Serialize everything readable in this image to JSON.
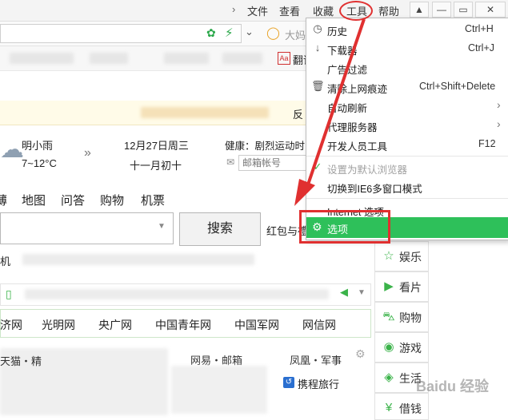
{
  "menubar": {
    "items": [
      "文件",
      "查看",
      "收藏",
      "工具",
      "帮助"
    ],
    "window_buttons": [
      "shirt-icon",
      "minimize-icon",
      "maximize-icon",
      "close-icon"
    ]
  },
  "addressbar": {
    "search_hint": "大妈"
  },
  "bookmarks": {
    "visible_item": "翻译"
  },
  "notice": {
    "text": "反"
  },
  "weather": {
    "condition": "明小雨",
    "temp": "7~12°C",
    "date": "12月27日周三",
    "lunar": "十一月初十",
    "health_prefix": "健康：剧烈运动时",
    "mail_placeholder": "邮箱帐号"
  },
  "nav": {
    "links": [
      "薄",
      "地图",
      "问答",
      "购物",
      "机票"
    ]
  },
  "search": {
    "button": "搜索",
    "side_text": "红包与禮"
  },
  "hot": {
    "prefix": "机"
  },
  "sites": {
    "links": [
      "济网",
      "光明网",
      "央广网",
      "中国青年网",
      "中国军网",
      "网信网"
    ]
  },
  "grid": {
    "cell_a": "网易・邮箱",
    "cell_b": "凤凰・军事",
    "cell_c": "携程旅行",
    "cell_d": "天猫・精"
  },
  "side_panel": {
    "items": [
      {
        "label": "娱乐",
        "icon": "star-icon"
      },
      {
        "label": "看片",
        "icon": "play-icon"
      },
      {
        "label": "购物",
        "icon": "cart-icon"
      },
      {
        "label": "游戏",
        "icon": "gamepad-icon"
      },
      {
        "label": "生活",
        "icon": "life-icon"
      },
      {
        "label": "借钱",
        "icon": "money-icon"
      }
    ]
  },
  "dropdown": {
    "items": [
      {
        "label": "历史",
        "shortcut": "Ctrl+H",
        "icon": "clock-icon"
      },
      {
        "label": "下载器",
        "shortcut": "Ctrl+J",
        "icon": "download-icon"
      },
      {
        "label": "广告过滤",
        "shortcut": "",
        "icon": ""
      },
      {
        "label": "清除上网痕迹",
        "shortcut": "Ctrl+Shift+Delete",
        "icon": "trash-icon"
      },
      {
        "label": "自动刷新",
        "shortcut": "",
        "icon": "",
        "submenu": true
      },
      {
        "label": "代理服务器",
        "shortcut": "",
        "icon": "",
        "submenu": true
      },
      {
        "label": "开发人员工具",
        "shortcut": "F12",
        "icon": ""
      },
      {
        "label": "设置为默认浏览器",
        "shortcut": "",
        "icon": "check-icon",
        "disabled": true
      },
      {
        "label": "切换到IE6多窗口模式",
        "shortcut": "",
        "icon": ""
      },
      {
        "label": "Internet 选项",
        "shortcut": "",
        "icon": ""
      },
      {
        "label": "选项",
        "shortcut": "",
        "icon": "gear-icon",
        "highlighted": true
      }
    ]
  },
  "watermark": "Baidu 经验",
  "colors": {
    "highlight": "#2ec05a",
    "annotation_red": "#e03030",
    "accent_green": "#3bb34a"
  }
}
